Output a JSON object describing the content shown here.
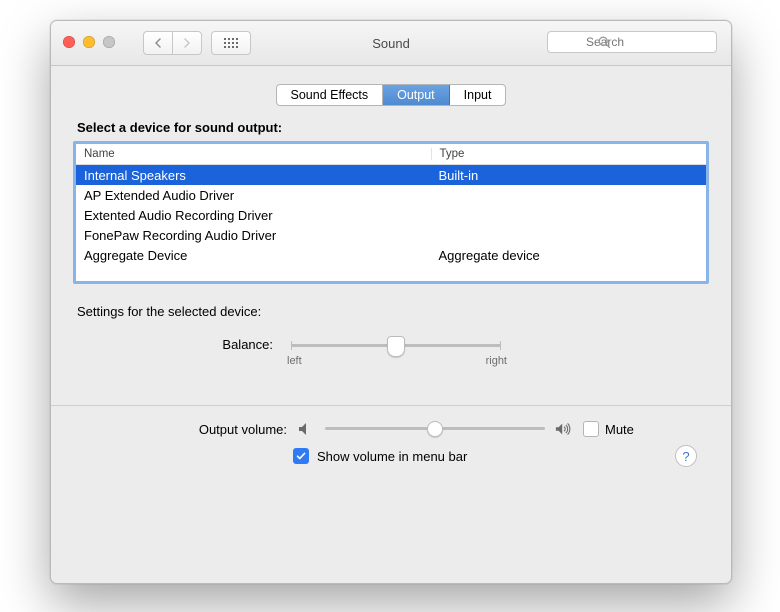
{
  "window": {
    "title": "Sound",
    "search_placeholder": "Search"
  },
  "tabs": [
    "Sound Effects",
    "Output",
    "Input"
  ],
  "output": {
    "heading": "Select a device for sound output:",
    "columns": [
      "Name",
      "Type"
    ],
    "devices": [
      {
        "name": "Internal Speakers",
        "type": "Built-in",
        "selected": true
      },
      {
        "name": "AP Extended Audio Driver",
        "type": ""
      },
      {
        "name": "Extented Audio Recording Driver",
        "type": ""
      },
      {
        "name": "FonePaw Recording Audio Driver",
        "type": ""
      },
      {
        "name": "Aggregate Device",
        "type": "Aggregate device"
      }
    ],
    "settings_heading": "Settings for the selected device:",
    "balance": {
      "label": "Balance:",
      "left_label": "left",
      "right_label": "right",
      "value": 0.5
    }
  },
  "help": {
    "glyph": "?"
  },
  "footer": {
    "output_volume_label": "Output volume:",
    "output_volume_value": 0.5,
    "mute_label": "Mute",
    "mute_checked": false,
    "show_volume_label": "Show volume in menu bar",
    "show_volume_checked": true
  }
}
